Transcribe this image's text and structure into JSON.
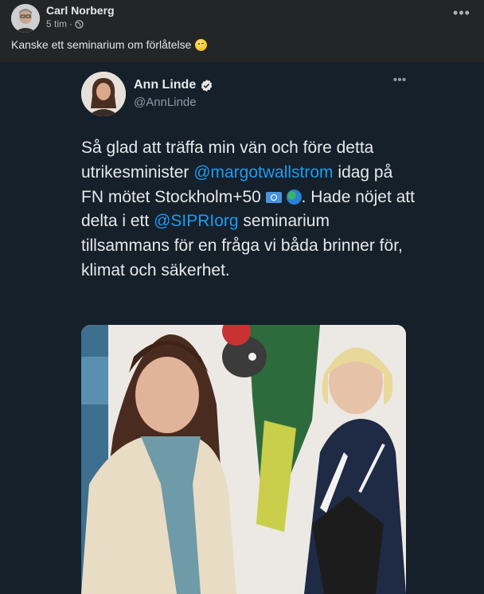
{
  "facebook_post": {
    "author": "Carl Norberg",
    "time": "5 tim",
    "separator": "·",
    "caption": "Kanske ett seminarium om förlåtelse",
    "more_icon": "ellipsis-icon",
    "audience_icon": "globe-icon"
  },
  "tweet": {
    "name": "Ann Linde",
    "handle": "@AnnLinde",
    "text_parts": {
      "p1": "Så glad att träffa min vän och före detta utrikesminister ",
      "mention1": "@margotwallstrom",
      "p2": " idag på FN mötet Stockholm+50 ",
      "p3": ". Hade nöjet att delta i ett ",
      "mention2": "@SIPRIorg",
      "p4": " seminarium tillsammans för en fråga vi båda brinner för, klimat och säkerhet."
    },
    "verified_icon": "verified-badge-icon",
    "emojis": [
      "un-flag-icon",
      "globe-africa-icon"
    ],
    "colors": {
      "background": "#15202b",
      "text": "#e7e9ea",
      "mention": "#1d9bf0",
      "secondary": "#8b98a5"
    }
  },
  "colors": {
    "fb_background": "#242526",
    "fb_text": "#e4e6eb",
    "fb_secondary": "#b0b3b8"
  }
}
